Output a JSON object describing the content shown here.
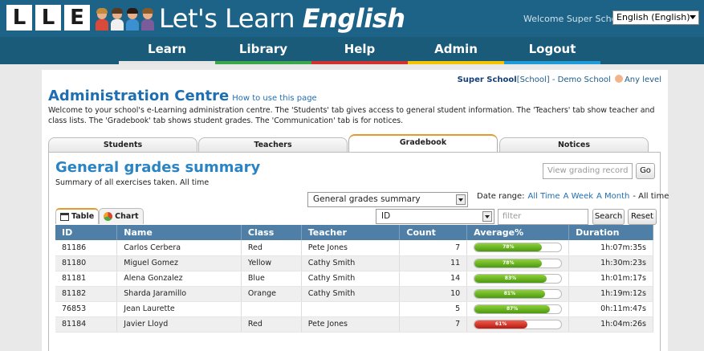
{
  "header": {
    "logo_letters": [
      "L",
      "L",
      "E"
    ],
    "title_prefix": "Let's Learn ",
    "title_emph": "English",
    "welcome": "Welcome Super School",
    "language": "English (English)"
  },
  "nav": [
    {
      "label": "Learn",
      "color": "#e6e6e6"
    },
    {
      "label": "Library",
      "color": "#3aa84a"
    },
    {
      "label": "Help",
      "color": "#d2322d"
    },
    {
      "label": "Admin",
      "color": "#f2c500"
    },
    {
      "label": "Logout",
      "color": "#1f9bd7"
    }
  ],
  "admin": {
    "school_name": "Super School",
    "school_suffix": "[School] - Demo School",
    "level": "Any level",
    "title": "Administration Centre",
    "howto": "How to use this page",
    "intro": "Welcome to your school's e-Learning administration centre. The 'Students' tab gives access to general student information. The 'Teachers' tab show teacher and class lists. The 'Gradebook' tab shows student grades. The 'Communication' tab is for notices."
  },
  "tabs": [
    "Students",
    "Teachers",
    "Gradebook",
    "Notices"
  ],
  "gradebook": {
    "title": "General grades summary",
    "subtitle": "Summary of all exercises taken. All time",
    "view_record_placeholder": "View grading record",
    "go_label": "Go",
    "summary_select": "General grades summary",
    "date_range_label": "Date range:",
    "range_all": "All Time",
    "range_week": "A Week",
    "range_month": "A Month",
    "range_current": "- All time",
    "field_select": "ID",
    "filter_placeholder": "filter",
    "search_label": "Search",
    "reset_label": "Reset",
    "table_tab": "Table",
    "chart_tab": "Chart"
  },
  "table": {
    "headers": [
      "ID",
      "Name",
      "Class",
      "Teacher",
      "Count",
      "Average%",
      "Duration"
    ],
    "rows": [
      {
        "id": "81186",
        "name": "Carlos Cerbera",
        "class": "Red",
        "teacher": "Pete Jones",
        "count": "7",
        "avg": 78,
        "avg_label": "78%",
        "duration": "1h:07m:35s"
      },
      {
        "id": "81180",
        "name": "Miguel Gomez",
        "class": "Yellow",
        "teacher": "Cathy Smith",
        "count": "11",
        "avg": 78,
        "avg_label": "78%",
        "duration": "1h:30m:23s"
      },
      {
        "id": "81181",
        "name": "Alena Gonzalez",
        "class": "Blue",
        "teacher": "Cathy Smith",
        "count": "14",
        "avg": 83,
        "avg_label": "83%",
        "duration": "1h:01m:17s"
      },
      {
        "id": "81182",
        "name": "Sharda Jaramillo",
        "class": "Orange",
        "teacher": "Cathy Smith",
        "count": "10",
        "avg": 81,
        "avg_label": "81%",
        "duration": "1h:19m:12s"
      },
      {
        "id": "76853",
        "name": "Jean Laurette",
        "class": "",
        "teacher": "",
        "count": "5",
        "avg": 87,
        "avg_label": "87%",
        "duration": "0h:11m:47s"
      },
      {
        "id": "81184",
        "name": "Javier Lloyd",
        "class": "Red",
        "teacher": "Pete Jones",
        "count": "7",
        "avg": 61,
        "avg_label": "61%",
        "duration": "1h:04m:26s"
      }
    ]
  }
}
